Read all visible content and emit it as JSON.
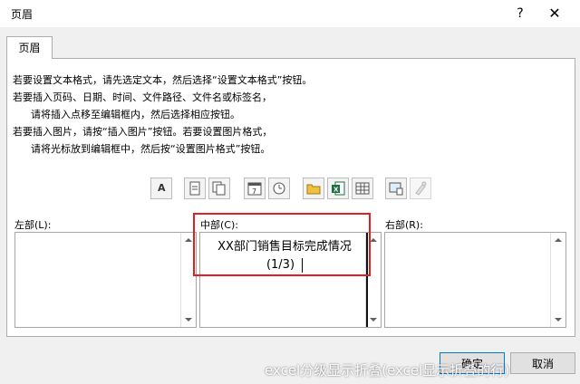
{
  "dialog": {
    "title": "页眉",
    "help": "?",
    "close": "✕"
  },
  "tab": {
    "label": "页眉"
  },
  "instructions": [
    "若要设置文本格式，请先选定文本，然后选择“设置文本格式”按钮。",
    "若要插入页码、日期、时间、文件路径、文件名或标签名，",
    "请将插入点移至编辑框内，然后选择相应按钮。",
    "若要插入图片，请按“插入图片”按钮。若要设置图片格式，",
    "请将光标放到编辑框中，然后按“设置图片格式”按钮。"
  ],
  "toolbar": {
    "format_text_glyph": "A"
  },
  "sections": {
    "left": {
      "label": "左部(L):"
    },
    "center": {
      "label": "中部(C):",
      "line1": "XX部门销售目标完成情况",
      "line2": "(1/3)"
    },
    "right": {
      "label": "右部(R):"
    }
  },
  "buttons": {
    "ok": "确定",
    "cancel": "取消"
  },
  "watermark": "excel分级显示折叠(excel显示折叠的行)",
  "colors": {
    "highlight": "#e02020",
    "accent": "#0078d7"
  }
}
